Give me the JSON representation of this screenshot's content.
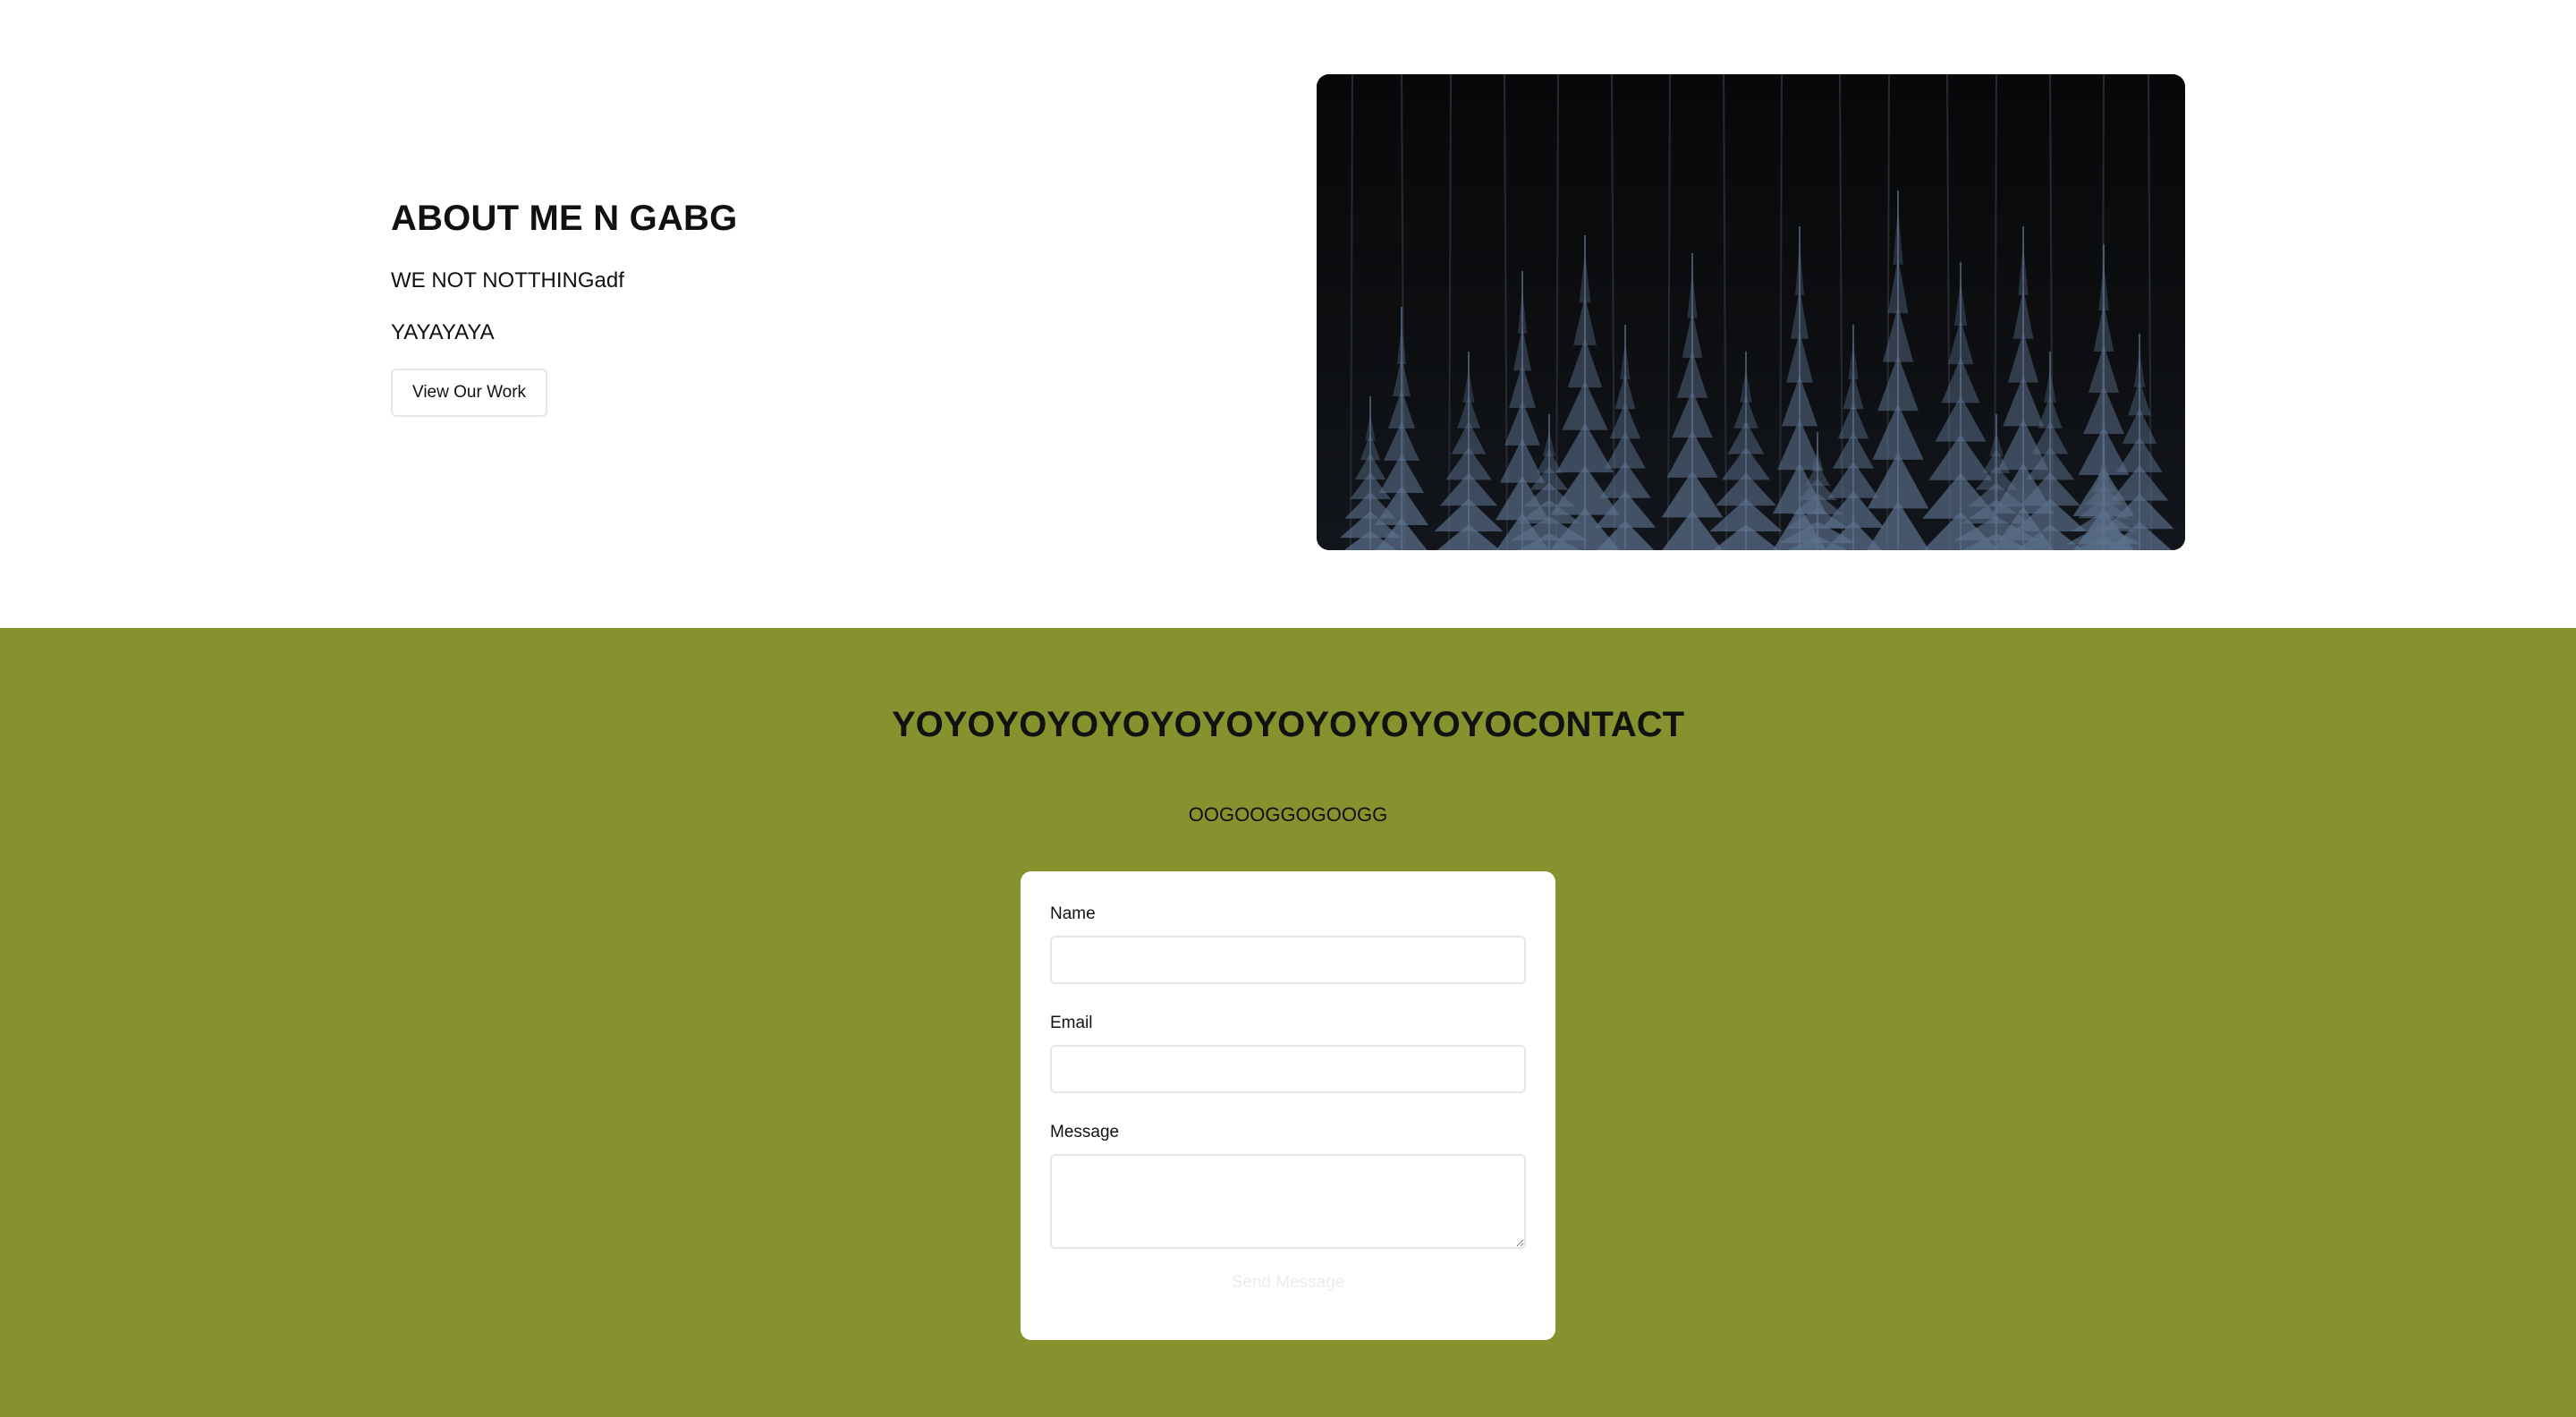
{
  "about": {
    "title": "ABOUT ME N GABG",
    "line1": "WE NOT NOTTHINGadf",
    "line2": "YAYAYAYA",
    "button_label": "View Our Work",
    "image_icon": "forest-photo"
  },
  "contact": {
    "title": "YOYOYOYOYOYOYOYOYOYOYOYOCONTACT",
    "subtitle": "OOGOOGGOGOOGG",
    "form": {
      "name_label": "Name",
      "name_value": "",
      "email_label": "Email",
      "email_value": "",
      "message_label": "Message",
      "message_value": "",
      "submit_label": "Send Message"
    }
  },
  "colors": {
    "contact_background": "#86922e",
    "page_background": "#ffffff",
    "text": "#111111",
    "image_background": "#0b0c0e",
    "tree_color": "#5d718d"
  }
}
